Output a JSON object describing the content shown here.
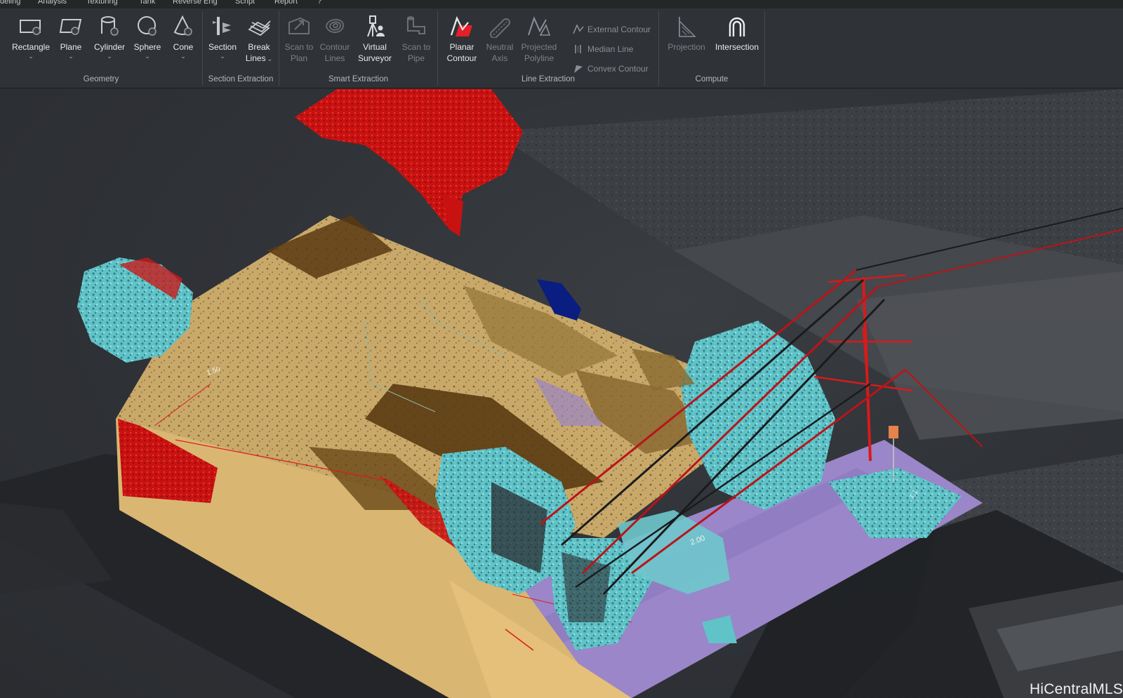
{
  "menu": [
    "deling",
    "Analysis",
    "Texturing",
    "Tank",
    "Reverse Eng",
    "Script",
    "Report",
    "?"
  ],
  "ribbon": {
    "geometry": {
      "label": "Geometry",
      "tools": [
        {
          "label": "Rectangle",
          "icon": "rectangle-icon"
        },
        {
          "label": "Plane",
          "icon": "plane-icon"
        },
        {
          "label": "Cylinder",
          "icon": "cylinder-icon"
        },
        {
          "label": "Sphere",
          "icon": "sphere-icon"
        },
        {
          "label": "Cone",
          "icon": "cone-icon"
        }
      ]
    },
    "section_extraction": {
      "label": "Section Extraction",
      "tools": [
        {
          "label": "Section",
          "icon": "section-icon"
        },
        {
          "label": "Break",
          "label2": "Lines",
          "icon": "break-lines-icon"
        }
      ]
    },
    "smart_extraction": {
      "label": "Smart Extraction",
      "tools": [
        {
          "label": "Scan to",
          "label2": "Plan",
          "icon": "scan-to-plan-icon"
        },
        {
          "label": "Contour",
          "label2": "Lines",
          "icon": "contour-lines-icon"
        },
        {
          "label": "Virtual",
          "label2": "Surveyor",
          "icon": "virtual-surveyor-icon"
        },
        {
          "label": "Scan to",
          "label2": "Pipe",
          "icon": "scan-to-pipe-icon"
        }
      ]
    },
    "line_extraction": {
      "label": "Line Extraction",
      "tools": [
        {
          "label": "Planar",
          "label2": "Contour",
          "icon": "planar-contour-icon"
        },
        {
          "label": "Neutral",
          "label2": "Axis",
          "icon": "neutral-axis-icon"
        },
        {
          "label": "Projected",
          "label2": "Polyline",
          "icon": "projected-polyline-icon"
        }
      ],
      "small_tools": [
        {
          "label": "External Contour",
          "icon": "external-contour-icon"
        },
        {
          "label": "Median Line",
          "icon": "median-line-icon"
        },
        {
          "label": "Convex Contour",
          "icon": "convex-contour-icon"
        }
      ]
    },
    "compute": {
      "label": "Compute",
      "tools": [
        {
          "label": "Projection",
          "icon": "projection-icon"
        },
        {
          "label": "Intersection",
          "icon": "intersection-icon"
        }
      ]
    }
  },
  "viewport": {
    "watermark": "HiCentralMLS",
    "annotations": [
      "2.00",
      "1.50",
      "1.1"
    ],
    "colors": {
      "roof": "#c9a96a",
      "roof_dark": "#5a3a12",
      "tree": "#62c8cc",
      "wall": "#d61414",
      "ground": "#9a86c8",
      "surroundings": "#55585d",
      "shadow": "#222427",
      "object": "#0a1d80"
    }
  }
}
